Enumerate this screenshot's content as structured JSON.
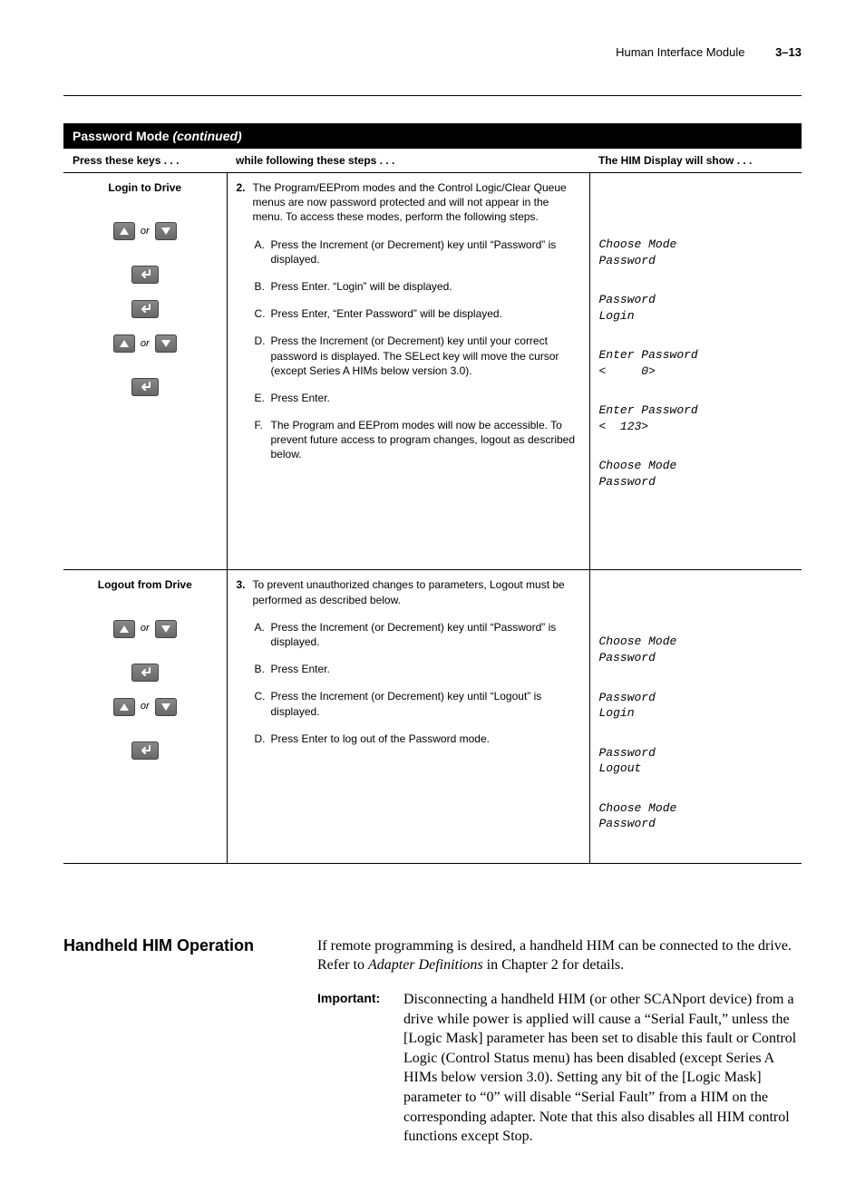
{
  "header": {
    "title": "Human Interface Module",
    "page": "3–13"
  },
  "table": {
    "title": "Password Mode",
    "title_suffix": "(continued)",
    "col1": "Press these keys . . .",
    "col2": "while following these steps . . .",
    "col3": "The HIM Display will show . . .",
    "rows": [
      {
        "heading": "Login to Drive",
        "num": "2.",
        "intro": "The Program/EEProm modes and the Control Logic/Clear Queue menus are now password protected and will not appear in the menu. To access these modes, perform the following steps.",
        "subs": [
          {
            "key": "updown",
            "l": "A.",
            "t": "Press the Increment (or Decrement) key until “Password” is displayed.",
            "him1": "Choose Mode",
            "him2": "Password"
          },
          {
            "key": "enter",
            "l": "B.",
            "t": "Press Enter. “Login” will be displayed.",
            "him1": "Password",
            "him2": "Login"
          },
          {
            "key": "enter",
            "l": "C.",
            "t": "Press Enter, “Enter Password” will be displayed.",
            "him1": "Enter Password",
            "him2": "<     0>"
          },
          {
            "key": "updown",
            "l": "D.",
            "t": "Press the Increment (or Decrement) key until your correct password is displayed. The SELect key will move the cursor (except Series A HIMs below version 3.0).",
            "him1": "Enter Password",
            "him2": "<  123>"
          },
          {
            "key": "enter",
            "l": "E.",
            "t": "Press Enter.",
            "him1": "Choose Mode",
            "him2": "Password"
          },
          {
            "key": "",
            "l": "F.",
            "t": "The Program and EEProm modes will now be accessible. To prevent future access to program changes, logout as described below.",
            "him1": "",
            "him2": ""
          }
        ]
      },
      {
        "heading": "Logout from Drive",
        "num": "3.",
        "intro": "To prevent unauthorized changes to parameters, Logout must be performed as described below.",
        "subs": [
          {
            "key": "updown",
            "l": "A.",
            "t": "Press the Increment (or Decrement) key until “Password” is displayed.",
            "him1": "Choose Mode",
            "him2": "Password"
          },
          {
            "key": "enter",
            "l": "B.",
            "t": "Press Enter.",
            "him1": "Password",
            "him2": "Login"
          },
          {
            "key": "updown",
            "l": "C.",
            "t": "Press the Increment (or Decrement) key until “Logout” is displayed.",
            "him1": "Password",
            "him2": "Logout"
          },
          {
            "key": "enter",
            "l": "D.",
            "t": "Press Enter to log out of the Password mode.",
            "him1": "Choose Mode",
            "him2": "Password"
          }
        ]
      }
    ],
    "or": "or"
  },
  "section": {
    "heading": "Handheld HIM Operation",
    "intro_a": "If remote programming is desired, a handheld HIM can be connected to the drive. Refer to ",
    "intro_em": "Adapter Definitions",
    "intro_b": " in Chapter 2 for details.",
    "imp_label": "Important:",
    "imp_body": "Disconnecting a handheld HIM (or other SCANport device) from a drive while power is applied will cause a “Serial Fault,” unless the [Logic Mask] parameter has been set to disable this fault or Control Logic (Control Status menu) has been disabled (except Series A HIMs below version 3.0). Setting any bit of the [Logic Mask] parameter to “0” will disable “Serial Fault” from a HIM on the corresponding adapter. Note that this also disables all HIM control functions except Stop."
  }
}
